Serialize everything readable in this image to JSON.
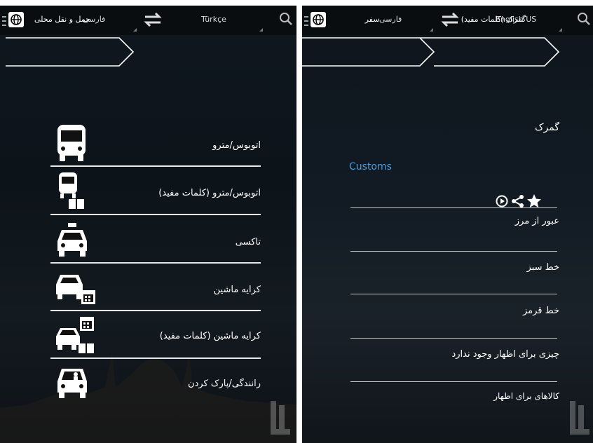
{
  "left": {
    "topbar": {
      "source_lang": "Türkçe",
      "target_lang": "فارسی"
    },
    "breadcrumb": {
      "items": [
        "حمل و نقل محلی"
      ]
    },
    "menu": [
      {
        "label": "اتوبوس/مترو",
        "icon": "bus-icon"
      },
      {
        "label": "اتوبوس/مترو (کلمات مفید)",
        "icon": "bus-book-icon"
      },
      {
        "label": "تاکسی",
        "icon": "taxi-icon"
      },
      {
        "label": "کرایه ماشین",
        "icon": "car-calendar-icon"
      },
      {
        "label": "کرایه ماشین (کلمات مفید)",
        "icon": "car-calendar-book-icon"
      },
      {
        "label": "رانندگی/پارک کردن",
        "icon": "car-driver-icon"
      }
    ]
  },
  "right": {
    "topbar": {
      "source_lang": "English US",
      "target_lang": "فارسی"
    },
    "breadcrumb": {
      "items": [
        "گمرک (کلمات مفید)",
        "سفر"
      ]
    },
    "heading": "گمرک",
    "translation": "Customs",
    "actions": [
      "star-icon",
      "share-icon",
      "play-icon"
    ],
    "phrases": [
      "عبور از مرز",
      "خط سبز",
      "خط قرمز",
      "چیزی برای اظهار وجود ندارد",
      "کالاهای برای اظهار"
    ]
  },
  "colors": {
    "accent": "#4a9de0",
    "background": "#0f161c",
    "text": "#ffffff"
  }
}
